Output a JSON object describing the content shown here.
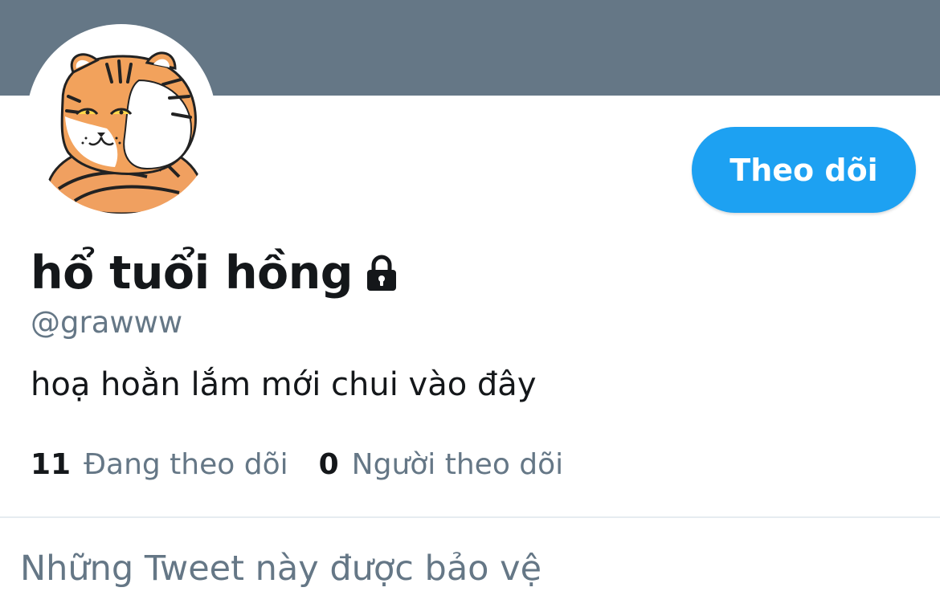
{
  "profile": {
    "display_name": "hổ tuổi hồng",
    "handle": "@grawww",
    "bio": "hoạ hoằn lắm mới chui vào đây",
    "locked_icon": "lock-icon",
    "avatar_icon": "tiger-avatar"
  },
  "actions": {
    "follow_label": "Theo dõi"
  },
  "stats": {
    "following_count": "11",
    "following_label": "Đang theo dõi",
    "followers_count": "0",
    "followers_label": "Người theo dõi"
  },
  "timeline": {
    "protected_title": "Những Tweet này được bảo vệ"
  },
  "colors": {
    "banner": "#657786",
    "accent": "#1da1f2",
    "text_primary": "#14171a",
    "text_secondary": "#657786"
  }
}
